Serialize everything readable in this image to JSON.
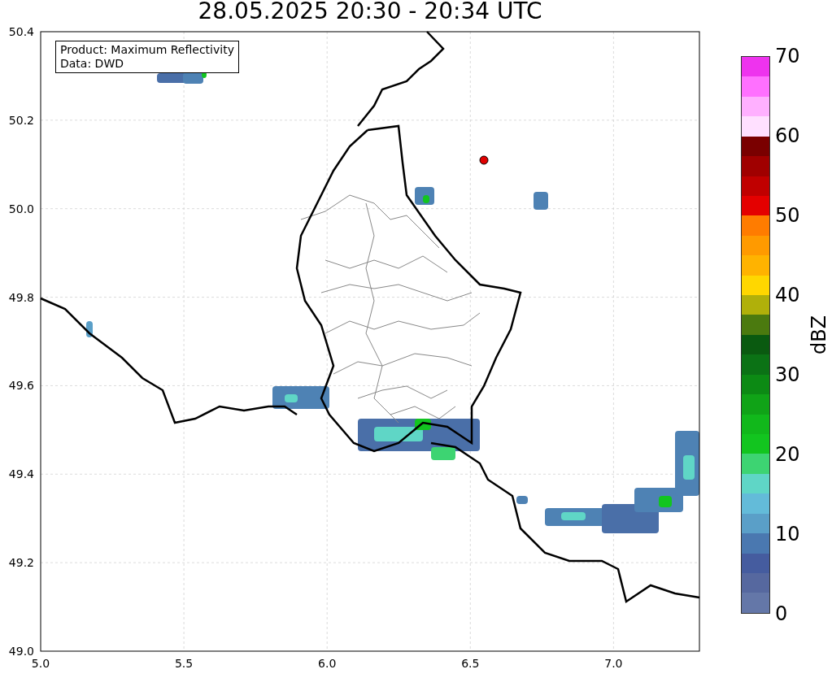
{
  "title": "28.05.2025 20:30 - 20:34 UTC",
  "map": {
    "legend": [
      "Product: Maximum Reflectivity",
      "Data: DWD"
    ],
    "x_ticks": [
      "5.0",
      "5.5",
      "6.0",
      "6.5",
      "7.0"
    ],
    "y_ticks": [
      "50.4",
      "50.2",
      "50.0",
      "49.8",
      "49.6",
      "49.4",
      "49.2",
      "49.0"
    ]
  },
  "colorbar": {
    "label": "dBZ",
    "ticks": [
      "70",
      "60",
      "50",
      "40",
      "30",
      "20",
      "10",
      "0"
    ],
    "segments": [
      {
        "color": "#ee33ee"
      },
      {
        "color": "#ff70ff"
      },
      {
        "color": "#ffb0ff"
      },
      {
        "color": "#ffe0ff"
      },
      {
        "color": "#7a0000"
      },
      {
        "color": "#a00000"
      },
      {
        "color": "#c00000"
      },
      {
        "color": "#e40000"
      },
      {
        "color": "#ff7c00"
      },
      {
        "color": "#ff9a00"
      },
      {
        "color": "#ffb300"
      },
      {
        "color": "#ffd700"
      },
      {
        "color": "#b0b00a"
      },
      {
        "color": "#4b7a0f"
      },
      {
        "color": "#0a5a10"
      },
      {
        "color": "#0b7215"
      },
      {
        "color": "#0c8a14"
      },
      {
        "color": "#10a317"
      },
      {
        "color": "#11b81b"
      },
      {
        "color": "#12c51f"
      },
      {
        "color": "#3dd472"
      },
      {
        "color": "#5fd6c6"
      },
      {
        "color": "#63bbd9"
      },
      {
        "color": "#5a9fc8"
      },
      {
        "color": "#4a78b0"
      },
      {
        "color": "#455c9f"
      },
      {
        "color": "#56689f"
      },
      {
        "color": "#6477a8"
      }
    ]
  }
}
